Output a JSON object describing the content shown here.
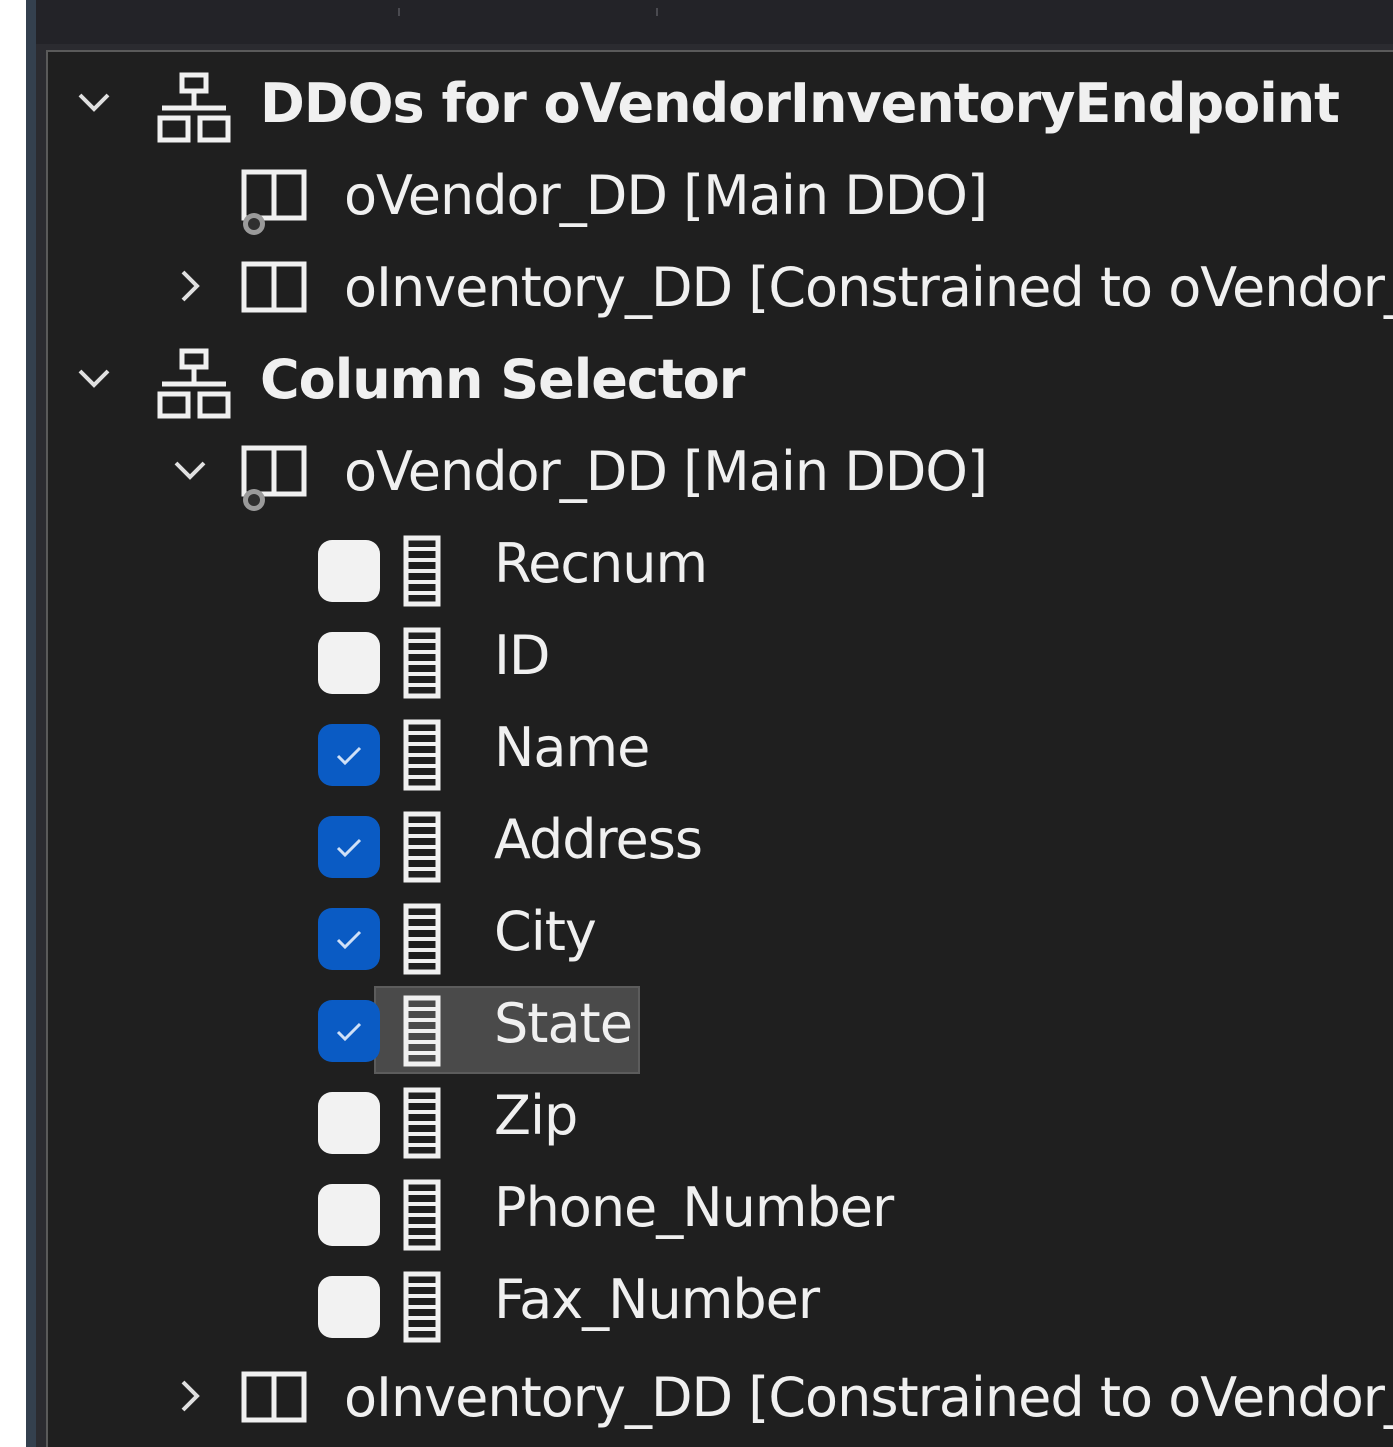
{
  "tree": {
    "groups": [
      {
        "label": "DDOs for oVendorInventoryEndpoint",
        "expanded": true,
        "icon": "hierarchy-icon",
        "children": [
          {
            "label": "oVendor_DD [Main DDO]",
            "icon": "main-ddo-book-icon",
            "expandable": false
          },
          {
            "label": "oInventory_DD [Constrained to oVendor_DD]",
            "icon": "book-icon",
            "expandable": true,
            "expanded": false
          }
        ]
      },
      {
        "label": "Column Selector",
        "expanded": true,
        "icon": "hierarchy-icon",
        "children": [
          {
            "label": "oVendor_DD [Main DDO]",
            "icon": "main-ddo-book-icon",
            "expandable": true,
            "expanded": true,
            "columns": [
              {
                "label": "Recnum",
                "checked": false
              },
              {
                "label": "ID",
                "checked": false
              },
              {
                "label": "Name",
                "checked": true
              },
              {
                "label": "Address",
                "checked": true
              },
              {
                "label": "City",
                "checked": true
              },
              {
                "label": "State",
                "checked": true,
                "selected": true
              },
              {
                "label": "Zip",
                "checked": false
              },
              {
                "label": "Phone_Number",
                "checked": false
              },
              {
                "label": "Fax_Number",
                "checked": false
              }
            ]
          },
          {
            "label": "oInventory_DD [Constrained to oVendor_DD]",
            "icon": "book-icon",
            "expandable": true,
            "expanded": false
          }
        ]
      }
    ]
  },
  "colors": {
    "checkbox_checked": "#0a5bc4",
    "checkbox_unchecked": "#f2f2f2",
    "selection": "#4a4a4a",
    "background": "#1f1f1f",
    "text": "#f0f0f0"
  }
}
